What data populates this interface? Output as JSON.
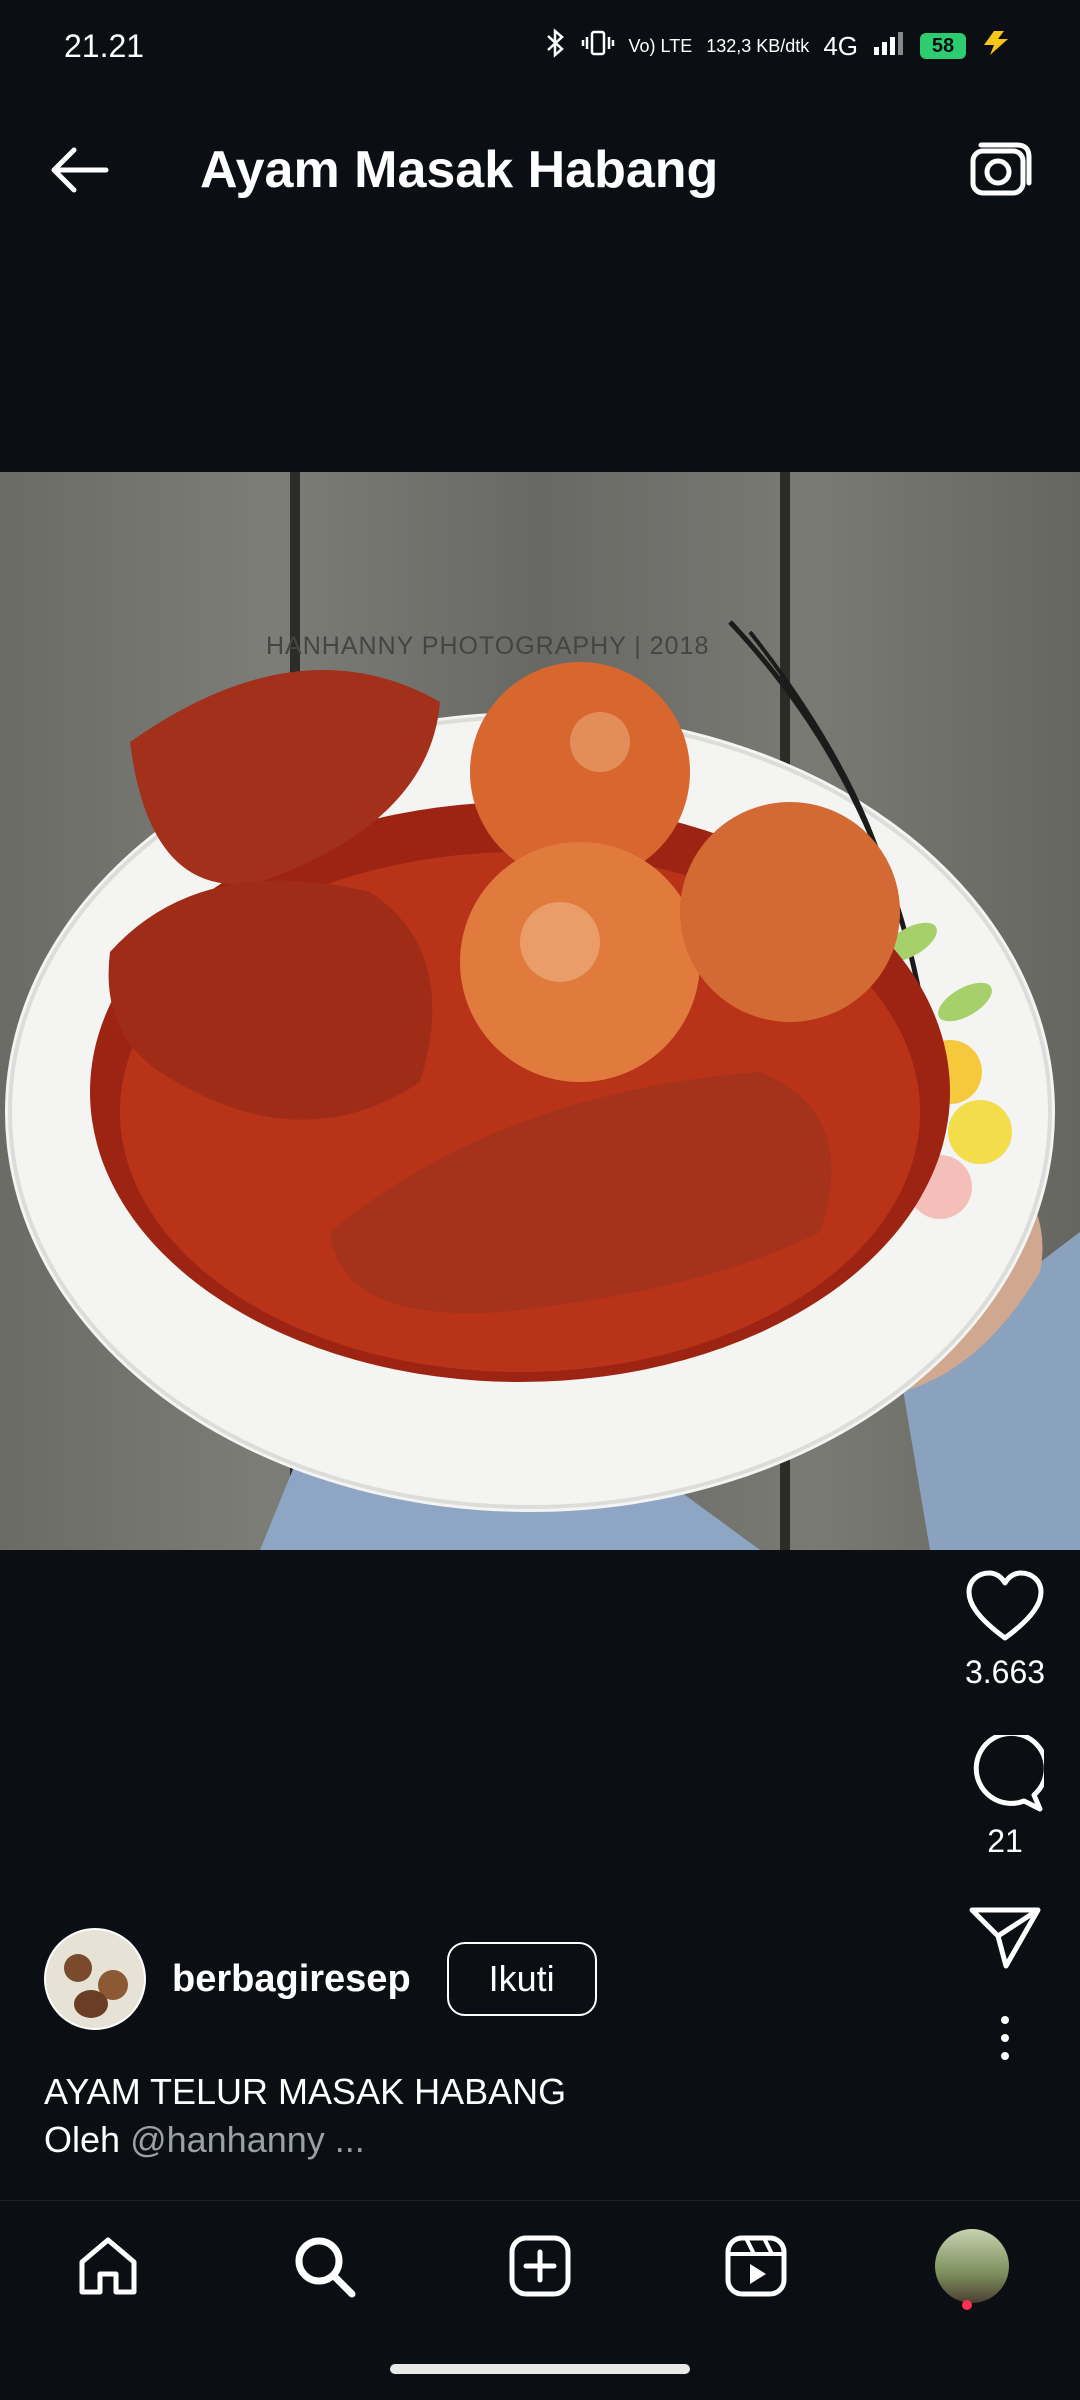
{
  "status_bar": {
    "time": "21.21",
    "volte": "Vo) LTE",
    "speed": "132,3 KB/dtk",
    "network": "4G",
    "battery": "58"
  },
  "header": {
    "title": "Ayam Masak Habang",
    "back_icon": "arrow-left-icon",
    "camera_icon": "camera-icon"
  },
  "photo": {
    "watermark": "HANHANNY PHOTOGRAPHY | 2018"
  },
  "actions": {
    "likes": "3.663",
    "comments": "21"
  },
  "author": {
    "username": "berbagiresep",
    "follow_label": "Ikuti"
  },
  "caption": {
    "line1": "AYAM TELUR MASAK HABANG",
    "line2_prefix": "Oleh",
    "mention": "@hanhanny ..."
  },
  "bottom_nav": {
    "items": [
      "home-icon",
      "search-icon",
      "add-icon",
      "reels-icon",
      "profile-avatar"
    ]
  },
  "colors": {
    "background": "#0b0e13",
    "accent_dot": "#ff2f55",
    "battery": "#2ecc71"
  }
}
